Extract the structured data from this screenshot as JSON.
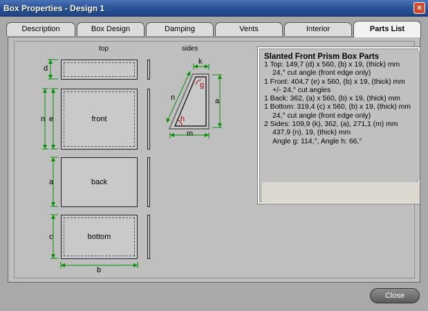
{
  "window": {
    "title": "Box Properties - Design 1"
  },
  "tabs": [
    "Description",
    "Box Design",
    "Damping",
    "Vents",
    "Interior",
    "Parts List"
  ],
  "active_tab": "Parts List",
  "diagram": {
    "top_label": "top",
    "sides_label": "sides",
    "panels": {
      "front": "front",
      "back": "back",
      "bottom": "bottom"
    },
    "dims": {
      "d": "d",
      "n": "n",
      "e": "e",
      "a": "a",
      "c": "c",
      "b": "b",
      "k": "k",
      "g": "g",
      "h": "h",
      "m": "m"
    }
  },
  "parts": {
    "title": "Slanted Front Prism Box Parts",
    "lines": [
      {
        "text": "1 Top:  149,7 (d) x 560, (b) x 19, (thick) mm",
        "indent": false
      },
      {
        "text": "24,° cut angle (front edge only)",
        "indent": true
      },
      {
        "text": "1 Front:  404,7 (e) x 560, (b) x 19, (thick) mm",
        "indent": false
      },
      {
        "text": "+/- 24,° cut angles",
        "indent": true
      },
      {
        "text": "1 Back:  362, (a) x 560, (b) x 19, (thick) mm",
        "indent": false
      },
      {
        "text": "1 Bottom:  319,4 (c) x 560, (b) x 19, (thick) mm",
        "indent": false
      },
      {
        "text": "24,° cut angle (front edge only)",
        "indent": true
      },
      {
        "text": "2 Sides:  109,9 (k), 362, (a), 271,1 (m) mm",
        "indent": false
      },
      {
        "text": "437,9 (n), 19, (thick) mm",
        "indent": true
      },
      {
        "text": "Angle g: 114,°, Angle h: 66,°",
        "indent": true
      }
    ]
  },
  "buttons": {
    "close": "Close",
    "close_x": "×"
  },
  "colors": {
    "dimension": "#009000",
    "angle": "#b00000",
    "title_bar": "#2c5597"
  }
}
